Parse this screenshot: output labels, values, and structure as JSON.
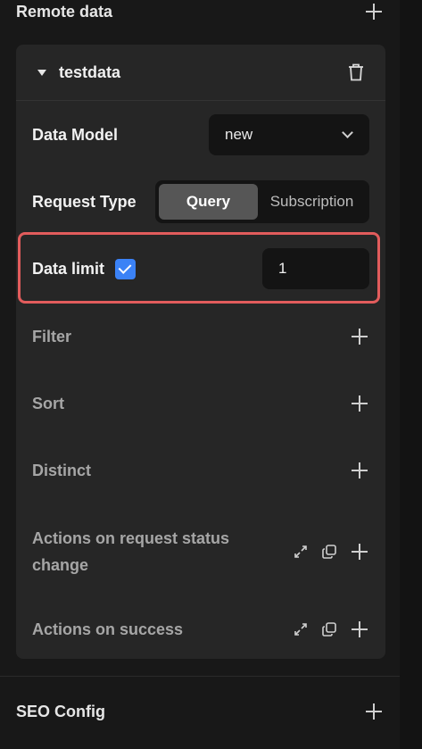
{
  "sections": {
    "remote_data": {
      "title": "Remote data"
    },
    "seo_config": {
      "title": "SEO Config"
    }
  },
  "card": {
    "title": "testdata",
    "data_model": {
      "label": "Data Model",
      "value": "new"
    },
    "request_type": {
      "label": "Request Type",
      "options": [
        "Query",
        "Subscription"
      ],
      "selected": "Query"
    },
    "data_limit": {
      "label": "Data limit",
      "checked": true,
      "value": "1"
    },
    "filter": {
      "label": "Filter"
    },
    "sort": {
      "label": "Sort"
    },
    "distinct": {
      "label": "Distinct"
    },
    "actions_status": {
      "label_line1": "Actions on request status",
      "label_line2": "change"
    },
    "actions_success": {
      "label": "Actions on success"
    }
  },
  "colors": {
    "accent": "#3b82f6",
    "highlight": "#e25c5c",
    "background": "#181818",
    "card": "#262626"
  }
}
